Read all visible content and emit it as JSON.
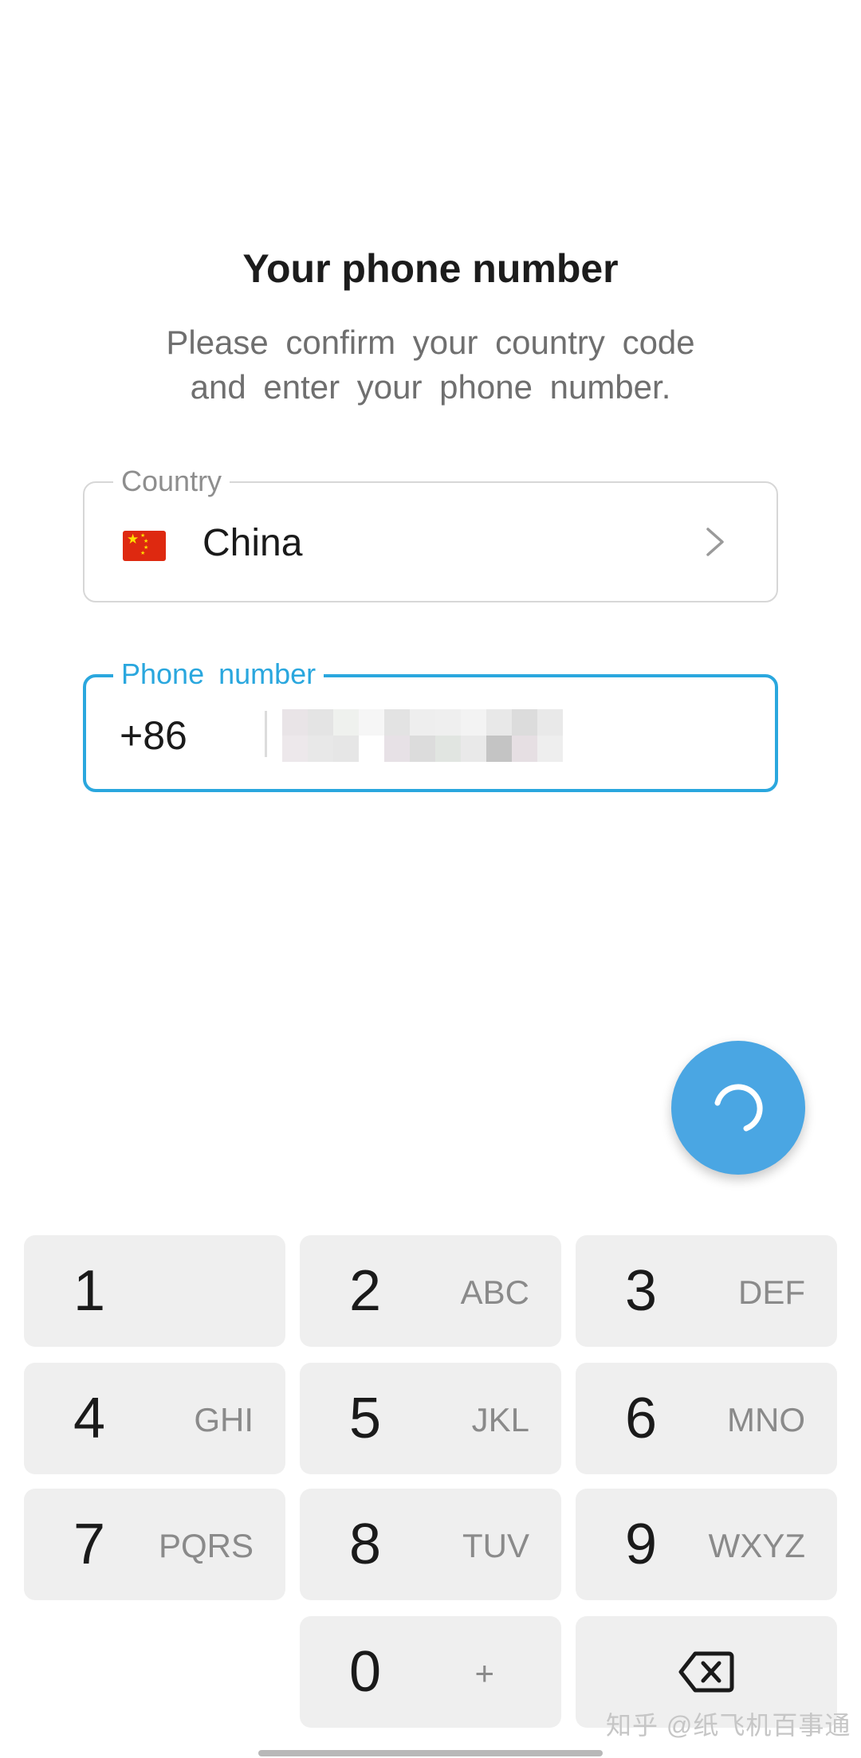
{
  "header": {
    "title": "Your phone number",
    "subtitle": "Please confirm your country code and enter your phone number."
  },
  "country_field": {
    "label": "Country",
    "flag_icon": "china-flag-icon",
    "value": "China",
    "chevron_icon": "chevron-right-icon"
  },
  "phone_field": {
    "label": "Phone number",
    "country_code": "+86",
    "value_masked": true
  },
  "fab": {
    "icon": "loading-spinner-icon",
    "color": "#4aa6e3"
  },
  "keypad": {
    "keys": [
      {
        "digit": "1",
        "letters": ""
      },
      {
        "digit": "2",
        "letters": "ABC"
      },
      {
        "digit": "3",
        "letters": "DEF"
      },
      {
        "digit": "4",
        "letters": "GHI"
      },
      {
        "digit": "5",
        "letters": "JKL"
      },
      {
        "digit": "6",
        "letters": "MNO"
      },
      {
        "digit": "7",
        "letters": "PQRS"
      },
      {
        "digit": "8",
        "letters": "TUV"
      },
      {
        "digit": "9",
        "letters": "WXYZ"
      },
      {
        "digit": "0",
        "letters": "+"
      }
    ],
    "backspace_icon": "backspace-icon"
  },
  "watermark": "知乎 @纸飞机百事通",
  "colors": {
    "accent": "#2aa7de",
    "key_background": "#efefef"
  }
}
